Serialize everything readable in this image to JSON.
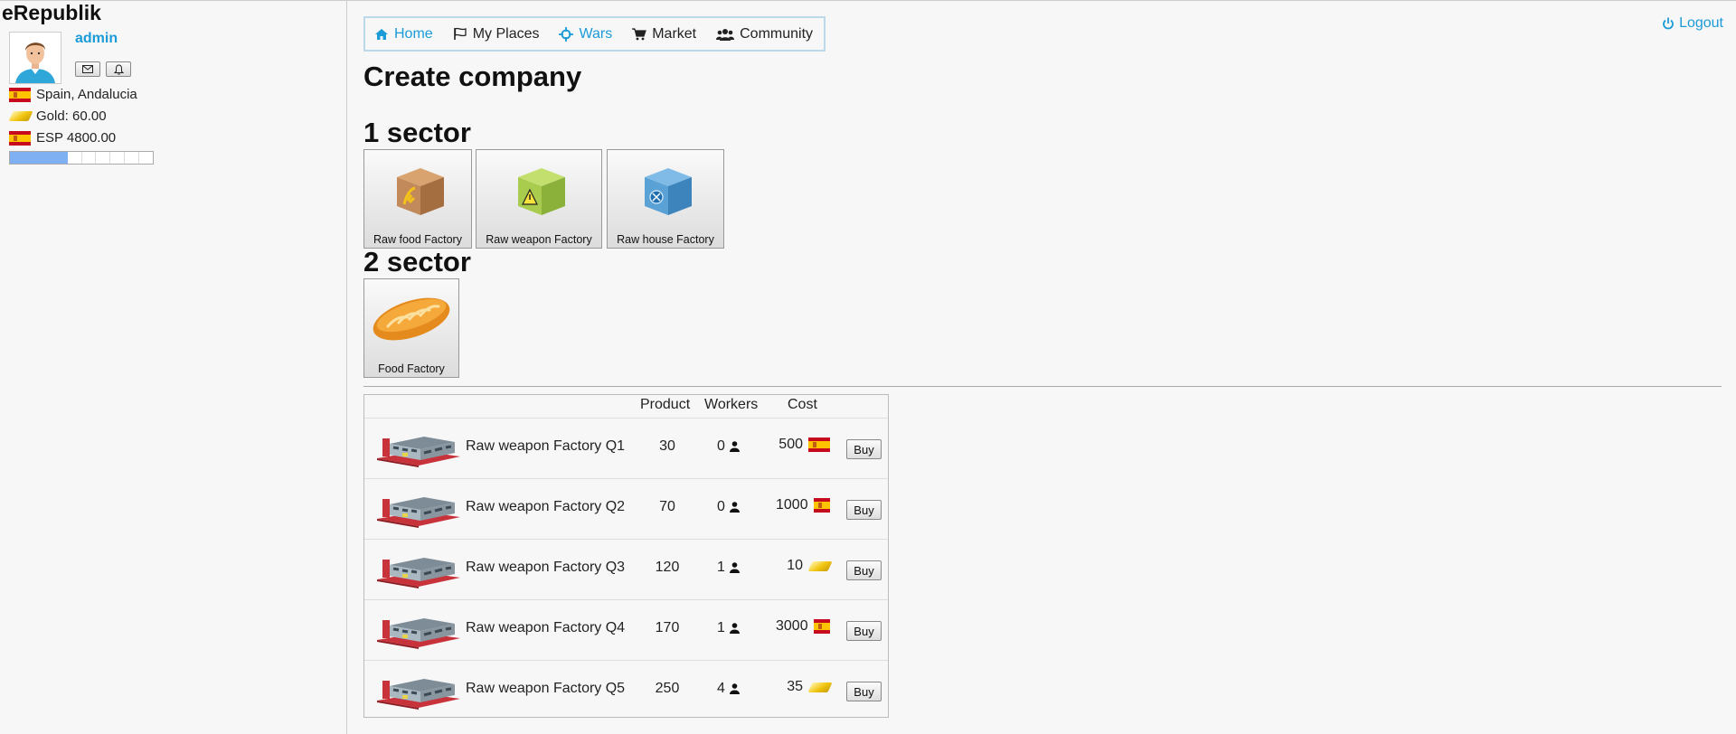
{
  "app": {
    "brand": "eRepublik"
  },
  "user": {
    "name": "admin",
    "location": "Spain, Andalucia",
    "gold": "Gold: 60.00",
    "currency": "ESP 4800.00",
    "xp_progress": 0.4
  },
  "nav": {
    "items": [
      {
        "label": "Home",
        "icon": "home-icon",
        "active": true
      },
      {
        "label": "My Places",
        "icon": "flag-icon",
        "active": false
      },
      {
        "label": "Wars",
        "icon": "crosshair-icon",
        "active": true
      },
      {
        "label": "Market",
        "icon": "cart-icon",
        "active": false
      },
      {
        "label": "Community",
        "icon": "users-icon",
        "active": false
      }
    ],
    "logout": "Logout"
  },
  "page": {
    "title": "Create company",
    "sector1": {
      "title": "1 sector",
      "tiles": [
        {
          "label": "Raw food Factory",
          "icon": "raw-food-box-icon"
        },
        {
          "label": "Raw weapon Factory",
          "icon": "raw-weapon-box-icon"
        },
        {
          "label": "Raw house Factory",
          "icon": "raw-house-box-icon"
        }
      ]
    },
    "sector2": {
      "title": "2 sector",
      "tiles": [
        {
          "label": "Food Factory",
          "icon": "bread-icon"
        }
      ]
    }
  },
  "table": {
    "headers": {
      "product": "Product",
      "workers": "Workers",
      "cost": "Cost"
    },
    "rows": [
      {
        "name": "Raw weapon Factory Q1",
        "product": "30",
        "workers": "0",
        "cost": "500",
        "currency": "esp-flag-icon",
        "buy": "Buy"
      },
      {
        "name": "Raw weapon Factory Q2",
        "product": "70",
        "workers": "0",
        "cost": "1000",
        "currency": "esp-flag-icon",
        "buy": "Buy"
      },
      {
        "name": "Raw weapon Factory Q3",
        "product": "120",
        "workers": "1",
        "cost": "10",
        "currency": "gold-icon",
        "buy": "Buy"
      },
      {
        "name": "Raw weapon Factory Q4",
        "product": "170",
        "workers": "1",
        "cost": "3000",
        "currency": "esp-flag-icon",
        "buy": "Buy"
      },
      {
        "name": "Raw weapon Factory Q5",
        "product": "250",
        "workers": "4",
        "cost": "35",
        "currency": "gold-icon",
        "buy": "Buy"
      }
    ]
  },
  "colors": {
    "link": "#1b9bd7",
    "progress": "#7fb1f2",
    "nav_border": "#bcd9ea"
  }
}
